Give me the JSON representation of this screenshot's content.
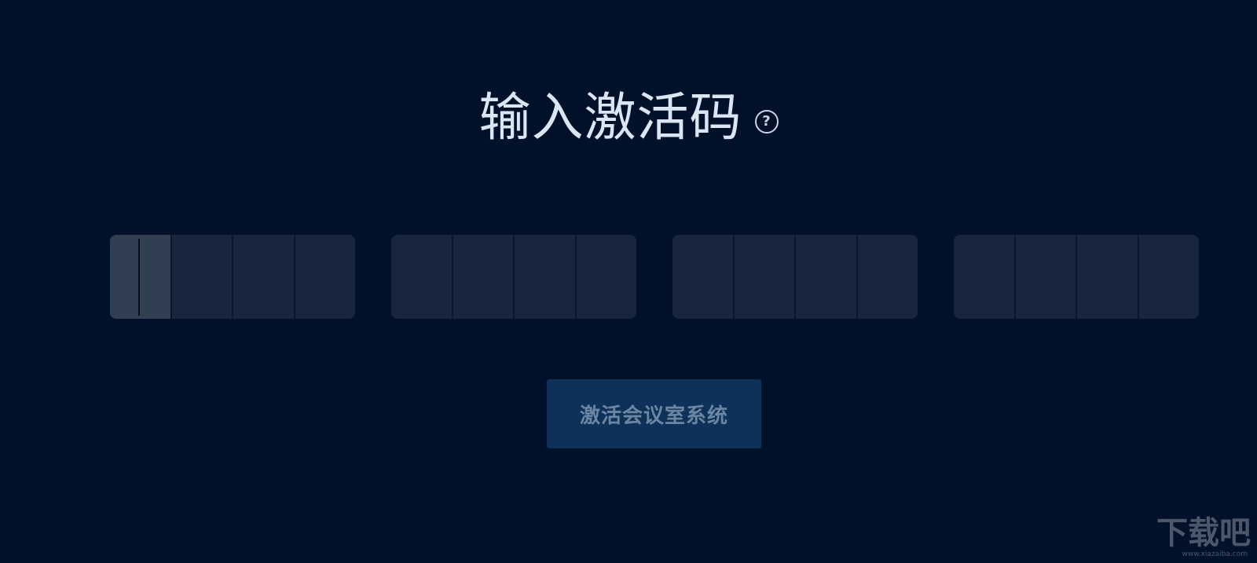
{
  "page": {
    "title": "输入激活码",
    "help_icon_glyph": "?",
    "help_icon": "question-circle-icon"
  },
  "activation_code": {
    "groups": [
      {
        "cells": [
          "",
          "",
          "",
          ""
        ]
      },
      {
        "cells": [
          "",
          "",
          "",
          ""
        ]
      },
      {
        "cells": [
          "",
          "",
          "",
          ""
        ]
      },
      {
        "cells": [
          "",
          "",
          "",
          ""
        ]
      }
    ],
    "focused_group": 0,
    "focused_cell": 0
  },
  "actions": {
    "activate_label": "激活会议室系统"
  },
  "watermark": {
    "main": "下载吧",
    "sub": "www.xiazaiba.com"
  },
  "colors": {
    "background": "#001129",
    "title": "#dbe6f5",
    "cell": "#17263d",
    "cell_active": "#313f53",
    "button_bg": "#0e3159",
    "button_text": "#6c85a3"
  }
}
